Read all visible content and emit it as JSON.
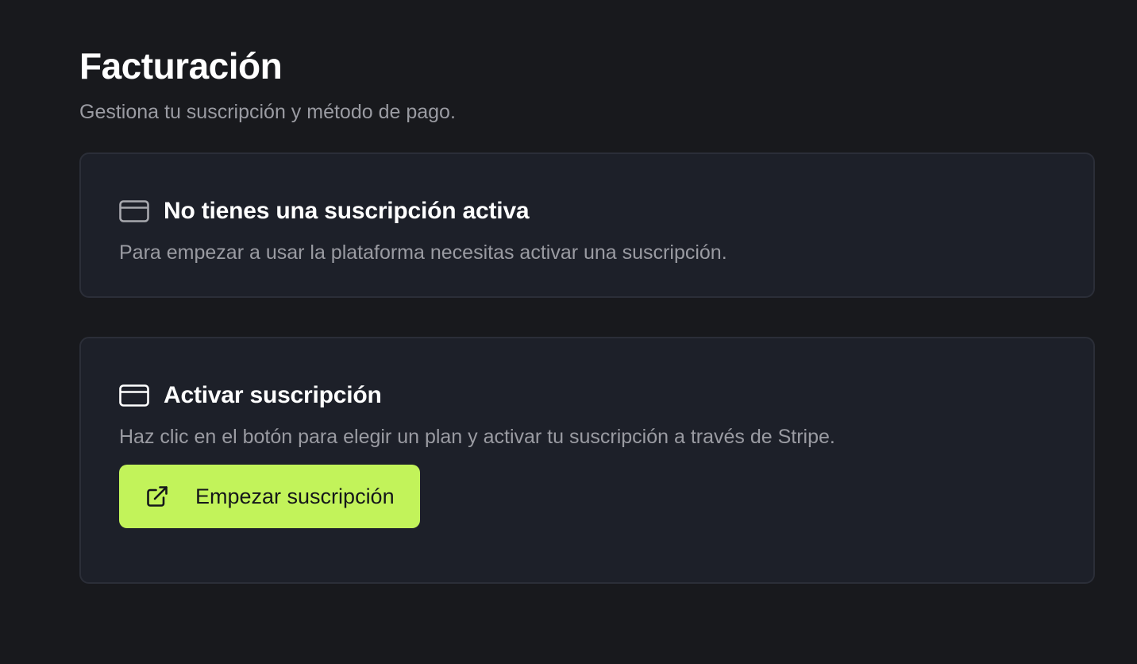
{
  "header": {
    "title": "Facturación",
    "subtitle": "Gestiona tu suscripción y método de pago."
  },
  "status_card": {
    "icon": "credit-card-icon",
    "title": "No tienes una suscripción activa",
    "description": "Para empezar a usar la plataforma necesitas activar una suscripción."
  },
  "activate_card": {
    "icon": "credit-card-icon",
    "title": "Activar suscripción",
    "description": "Haz clic en el botón para elegir un plan y activar tu suscripción a través de Stripe.",
    "button": {
      "icon": "external-link-icon",
      "label": "Empezar suscripción"
    }
  },
  "colors": {
    "background": "#18191d",
    "card_background": "#1d2029",
    "card_border": "#2b2e38",
    "text_primary": "#ffffff",
    "text_secondary": "#9a9ba2",
    "accent": "#c2f35a"
  }
}
